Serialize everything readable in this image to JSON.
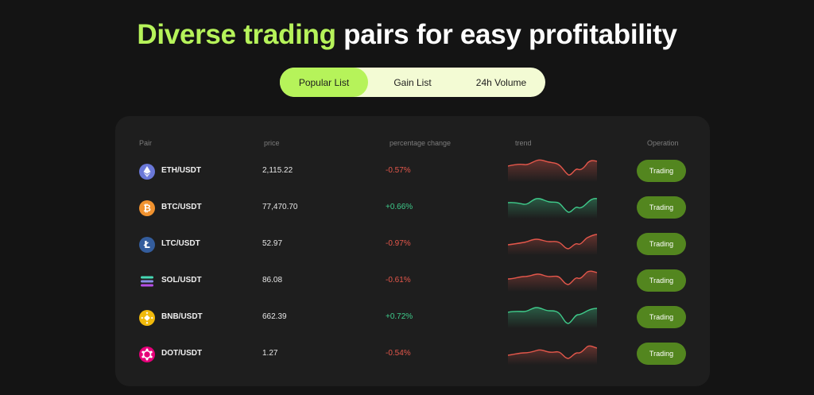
{
  "headline": {
    "accent": "Diverse trading",
    "rest": " pairs for easy profitability"
  },
  "tabs": [
    {
      "label": "Popular List",
      "active": true
    },
    {
      "label": "Gain List",
      "active": false
    },
    {
      "label": "24h Volume",
      "active": false
    }
  ],
  "table": {
    "headers": {
      "pair": "Pair",
      "price": "price",
      "change": "percentage change",
      "trend": "trend",
      "operation": "Operation"
    },
    "rows": [
      {
        "pair": "ETH/USDT",
        "price": "2,115.22",
        "change": "-0.57%",
        "direction": "down",
        "icon": "ethereum-icon",
        "button": "Trading"
      },
      {
        "pair": "BTC/USDT",
        "price": "77,470.70",
        "change": "+0.66%",
        "direction": "up",
        "icon": "bitcoin-icon",
        "button": "Trading"
      },
      {
        "pair": "LTC/USDT",
        "price": "52.97",
        "change": "-0.97%",
        "direction": "down",
        "icon": "litecoin-icon",
        "button": "Trading"
      },
      {
        "pair": "SOL/USDT",
        "price": "86.08",
        "change": "-0.61%",
        "direction": "down",
        "icon": "solana-icon",
        "button": "Trading"
      },
      {
        "pair": "BNB/USDT",
        "price": "662.39",
        "change": "+0.72%",
        "direction": "up",
        "icon": "bnb-icon",
        "button": "Trading"
      },
      {
        "pair": "DOT/USDT",
        "price": "1.27",
        "change": "-0.54%",
        "direction": "down",
        "icon": "polkadot-icon",
        "button": "Trading"
      }
    ]
  },
  "colors": {
    "accent": "#b6f35a",
    "down": "#e4574b",
    "up": "#3fcb8b",
    "button": "#53861f",
    "eth": "#6a78d8",
    "btc": "#f0922f",
    "ltc": "#345d9d",
    "sol_top": "#46d8b4",
    "sol_mid": "#8a8ee8",
    "sol_bot": "#b54ee8",
    "bnb": "#f0b90b",
    "dot": "#e6007a"
  }
}
